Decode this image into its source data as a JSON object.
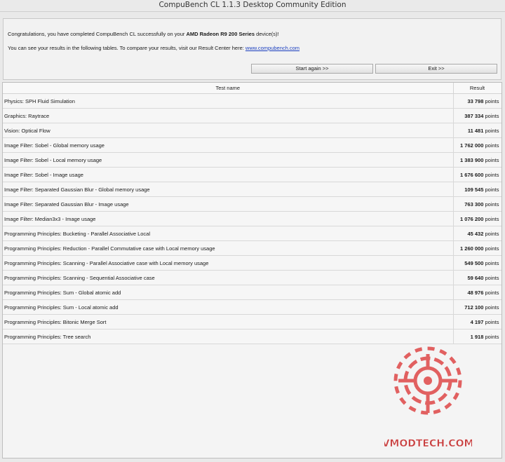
{
  "window": {
    "title": "CompuBench CL 1.1.3 Desktop Community Edition"
  },
  "info": {
    "line1_prefix": "Congratulations, you have completed CompuBench CL successfully on your ",
    "device": "AMD Radeon R9 200 Series",
    "line1_suffix": " device(s)!",
    "line2_prefix": "You can see your results in the following tables. To compare your results, visit our Result Center here: ",
    "link": "www.compubench.com",
    "start_again_label": "Start again >>",
    "exit_label": "Exit >>"
  },
  "table": {
    "headers": [
      "Test name",
      "Result"
    ],
    "rows": [
      {
        "name": "Physics: SPH Fluid Simulation",
        "value": "33 798",
        "unit": " points"
      },
      {
        "name": "Graphics: Raytrace",
        "value": "387 334",
        "unit": " points"
      },
      {
        "name": "Vision: Optical Flow",
        "value": "11 481",
        "unit": " points"
      },
      {
        "name": "Image Filter: Sobel - Global memory usage",
        "value": "1 762 000",
        "unit": " points"
      },
      {
        "name": "Image Filter: Sobel - Local memory usage",
        "value": "1 383 900",
        "unit": " points"
      },
      {
        "name": "Image Filter: Sobel - Image usage",
        "value": "1 676 600",
        "unit": " points"
      },
      {
        "name": "Image Filter: Separated Gaussian Blur - Global memory usage",
        "value": "109 545",
        "unit": " points"
      },
      {
        "name": "Image Filter: Separated Gaussian Blur - Image usage",
        "value": "763 300",
        "unit": " points"
      },
      {
        "name": "Image Filter: Median3x3 - Image usage",
        "value": "1 076 200",
        "unit": " points"
      },
      {
        "name": "Programming Principles: Bucketing - Parallel Associative Local",
        "value": "45 432",
        "unit": " points"
      },
      {
        "name": "Programming Principles: Reduction - Parallel Commutative case with Local memory usage",
        "value": "1 260 000",
        "unit": " points"
      },
      {
        "name": "Programming Principles: Scanning - Parallel Associative case with Local memory usage",
        "value": "549 500",
        "unit": " points"
      },
      {
        "name": "Programming Principles: Scanning - Sequential Associative case",
        "value": "59 640",
        "unit": " points"
      },
      {
        "name": "Programming Principles: Sum - Global atomic add",
        "value": "48 976",
        "unit": " points"
      },
      {
        "name": "Programming Principles: Sum - Local atomic add",
        "value": "712 100",
        "unit": " points"
      },
      {
        "name": "Programming Principles: Bitonic Merge Sort",
        "value": "4 197",
        "unit": " points"
      },
      {
        "name": "Programming Principles: Tree search",
        "value": "1 918",
        "unit": " points"
      }
    ]
  },
  "watermark": {
    "text": "VMODTECH.COM",
    "color": "#e05050"
  }
}
